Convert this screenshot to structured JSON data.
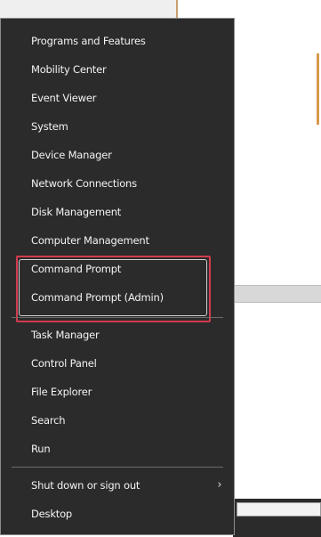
{
  "menu": {
    "items": [
      "Programs and Features",
      "Mobility Center",
      "Event Viewer",
      "System",
      "Device Manager",
      "Network Connections",
      "Disk Management",
      "Computer Management",
      "Command Prompt",
      "Command Prompt (Admin)",
      "Task Manager",
      "Control Panel",
      "File Explorer",
      "Search",
      "Run",
      "Shut down or sign out",
      "Desktop"
    ]
  },
  "colors": {
    "menu_bg": "#2b2b2b",
    "highlight_border": "#d23c4e"
  },
  "icons": {
    "submenu": "chevron-right-icon"
  }
}
